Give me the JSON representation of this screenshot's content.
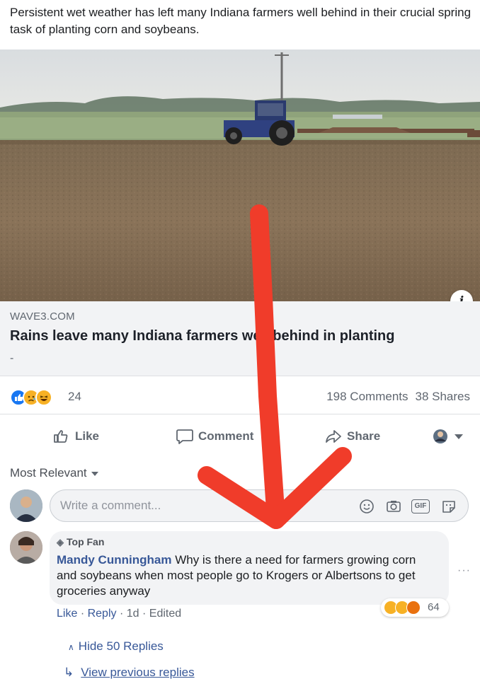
{
  "post": {
    "text": "Persistent wet weather has left many Indiana farmers well behind in their crucial spring task of planting corn and soybeans."
  },
  "link": {
    "domain": "WAVE3.COM",
    "title": "Rains leave many Indiana farmers well behind in planting",
    "description": "-",
    "info_icon": "info-icon",
    "info_glyph": "i"
  },
  "reactions": {
    "icons": [
      "like-reaction-icon",
      "sad-reaction-icon",
      "haha-reaction-icon"
    ],
    "count": "24",
    "comments": "198 Comments",
    "shares": "38 Shares"
  },
  "actions": {
    "like": "Like",
    "comment": "Comment",
    "share": "Share"
  },
  "comments_section": {
    "sort_label": "Most Relevant",
    "input_placeholder": "Write a comment...",
    "input_icons": [
      "emoji-icon",
      "camera-icon",
      "gif-icon",
      "sticker-icon"
    ],
    "gif_label": "GIF"
  },
  "comment": {
    "badge": "Top Fan",
    "author": "Mandy Cunningham",
    "text": "Why is there a need for farmers growing corn and soybeans when most people go to Krogers or Albertsons to get groceries anyway",
    "like": "Like",
    "reply": "Reply",
    "time": "1d",
    "edited": "Edited",
    "sep": "·",
    "reaction_count": "64",
    "more": "···"
  },
  "replies": {
    "hide": "Hide 50 Replies",
    "view_previous": "View previous replies"
  },
  "colors": {
    "link_blue": "#385898",
    "facebook_blue": "#1877f2",
    "annotation_red": "#f03c2a"
  }
}
